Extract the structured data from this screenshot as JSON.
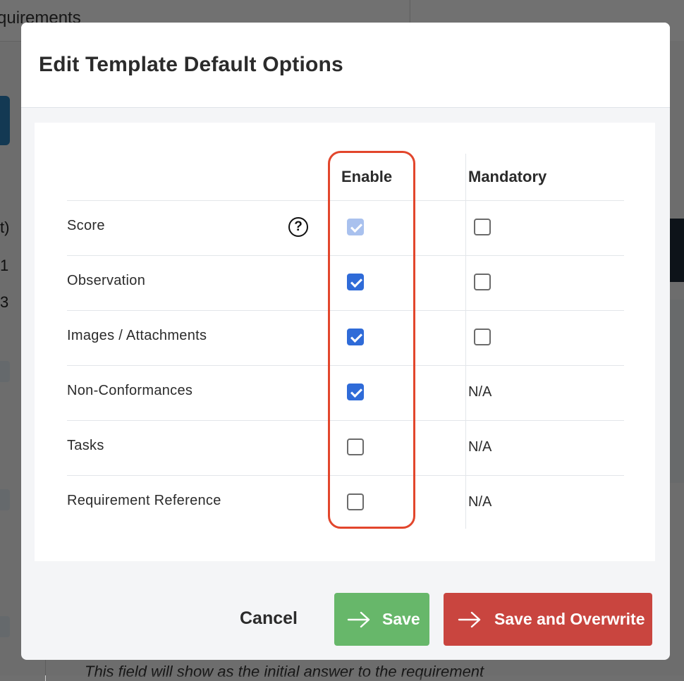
{
  "background": {
    "page_title_fragment": "quirements",
    "side_fragments": [
      "t)",
      "1",
      "3"
    ],
    "bottom_text": "This field will show as the initial answer to the requirement"
  },
  "modal": {
    "title": "Edit Template Default Options",
    "columns": {
      "enable": "Enable",
      "mandatory": "Mandatory"
    },
    "rows": [
      {
        "label": "Score",
        "has_help": true,
        "help_glyph": "?",
        "enable_checked": true,
        "enable_disabled": true,
        "mandatory": "checkbox",
        "mandatory_checked": false
      },
      {
        "label": "Observation",
        "has_help": false,
        "enable_checked": true,
        "enable_disabled": false,
        "mandatory": "checkbox",
        "mandatory_checked": false
      },
      {
        "label": "Images / Attachments",
        "has_help": false,
        "enable_checked": true,
        "enable_disabled": false,
        "mandatory": "checkbox",
        "mandatory_checked": false
      },
      {
        "label": "Non-Conformances",
        "has_help": false,
        "enable_checked": true,
        "enable_disabled": false,
        "mandatory": "N/A"
      },
      {
        "label": "Tasks",
        "has_help": false,
        "enable_checked": false,
        "enable_disabled": false,
        "mandatory": "N/A"
      },
      {
        "label": "Requirement Reference",
        "has_help": false,
        "enable_checked": false,
        "enable_disabled": false,
        "mandatory": "N/A"
      }
    ],
    "buttons": {
      "cancel": "Cancel",
      "save": "Save",
      "save_overwrite": "Save and Overwrite"
    }
  },
  "icons": {
    "help": "question-circle-icon",
    "button_arrow": "arrow-right-icon"
  },
  "colors": {
    "checkbox_checked": "#2f6bd8",
    "checkbox_checked_disabled": "#a9c1ee",
    "save_button": "#67b76a",
    "overwrite_button": "#c9453f",
    "highlight": "#e2462c"
  }
}
